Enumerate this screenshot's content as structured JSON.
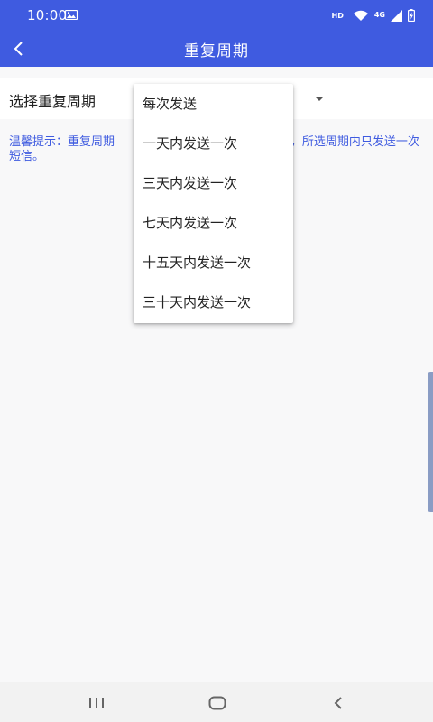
{
  "status_bar": {
    "time": "10:00",
    "hd": "HD",
    "network": "4G",
    "icons": [
      "gallery-icon",
      "wifi-icon",
      "signal-icon",
      "battery-charging-icon"
    ]
  },
  "app_bar": {
    "title": "重复周期",
    "back_icon": "chevron-left-icon"
  },
  "repeat_row": {
    "label": "选择重复周期"
  },
  "hint": {
    "text": "温馨提示：重复周期                                            电，所选周期内只发送一次短信。"
  },
  "dropdown": {
    "options": [
      "每次发送",
      "一天内发送一次",
      "三天内发送一次",
      "七天内发送一次",
      "十五天内发送一次",
      "三十天内发送一次"
    ]
  },
  "nav_bar": {
    "icons": [
      "recents-icon",
      "home-icon",
      "back-icon"
    ]
  },
  "colors": {
    "primary": "#3f5be0",
    "background": "#f8f8f9",
    "hint_text": "#3f5be0"
  }
}
